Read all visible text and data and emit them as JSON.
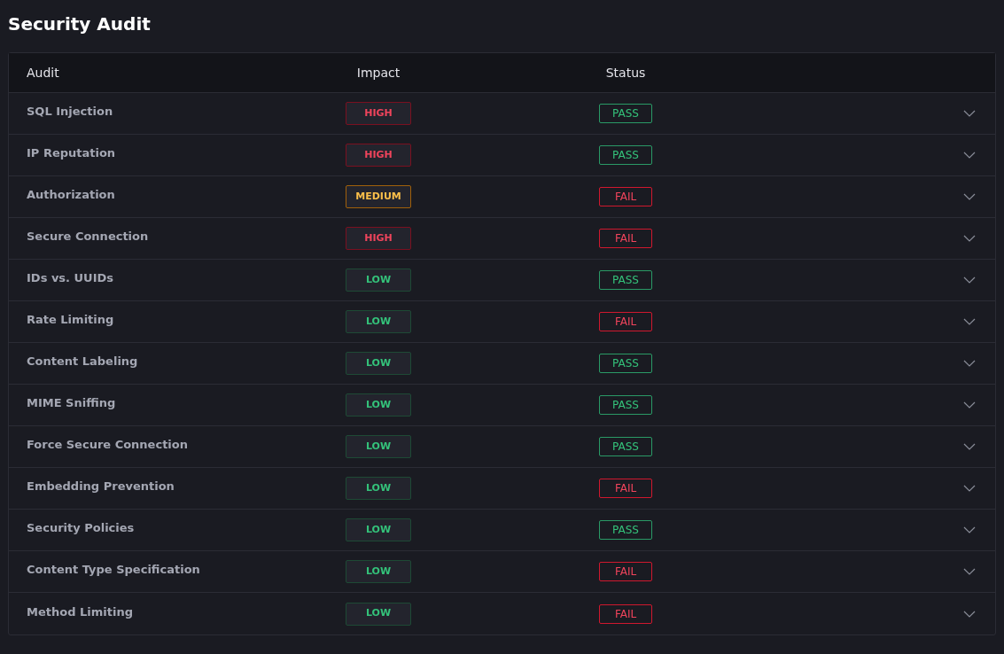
{
  "title": "Security Audit",
  "columns": [
    "Audit",
    "Impact",
    "Status"
  ],
  "rows": [
    {
      "audit": "SQL Injection",
      "impact": {
        "kind": "high",
        "label": "HIGH"
      },
      "status": {
        "kind": "pass",
        "label": "PASS"
      }
    },
    {
      "audit": "IP Reputation",
      "impact": {
        "kind": "high",
        "label": "HIGH"
      },
      "status": {
        "kind": "pass",
        "label": "PASS"
      }
    },
    {
      "audit": "Authorization",
      "impact": {
        "kind": "medium",
        "label": "MEDIUM"
      },
      "status": {
        "kind": "fail",
        "label": "FAIL"
      }
    },
    {
      "audit": "Secure Connection",
      "impact": {
        "kind": "high",
        "label": "HIGH"
      },
      "status": {
        "kind": "fail",
        "label": "FAIL"
      }
    },
    {
      "audit": "IDs vs. UUIDs",
      "impact": {
        "kind": "low",
        "label": "LOW"
      },
      "status": {
        "kind": "pass",
        "label": "PASS"
      }
    },
    {
      "audit": "Rate Limiting",
      "impact": {
        "kind": "low",
        "label": "LOW"
      },
      "status": {
        "kind": "fail",
        "label": "FAIL"
      }
    },
    {
      "audit": "Content Labeling",
      "impact": {
        "kind": "low",
        "label": "LOW"
      },
      "status": {
        "kind": "pass",
        "label": "PASS"
      }
    },
    {
      "audit": "MIME Sniffing",
      "impact": {
        "kind": "low",
        "label": "LOW"
      },
      "status": {
        "kind": "pass",
        "label": "PASS"
      }
    },
    {
      "audit": "Force Secure Connection",
      "impact": {
        "kind": "low",
        "label": "LOW"
      },
      "status": {
        "kind": "pass",
        "label": "PASS"
      }
    },
    {
      "audit": "Embedding Prevention",
      "impact": {
        "kind": "low",
        "label": "LOW"
      },
      "status": {
        "kind": "fail",
        "label": "FAIL"
      }
    },
    {
      "audit": "Security Policies",
      "impact": {
        "kind": "low",
        "label": "LOW"
      },
      "status": {
        "kind": "pass",
        "label": "PASS"
      }
    },
    {
      "audit": "Content Type Specification",
      "impact": {
        "kind": "low",
        "label": "LOW"
      },
      "status": {
        "kind": "fail",
        "label": "FAIL"
      }
    },
    {
      "audit": "Method Limiting",
      "impact": {
        "kind": "low",
        "label": "LOW"
      },
      "status": {
        "kind": "fail",
        "label": "FAIL"
      }
    }
  ]
}
